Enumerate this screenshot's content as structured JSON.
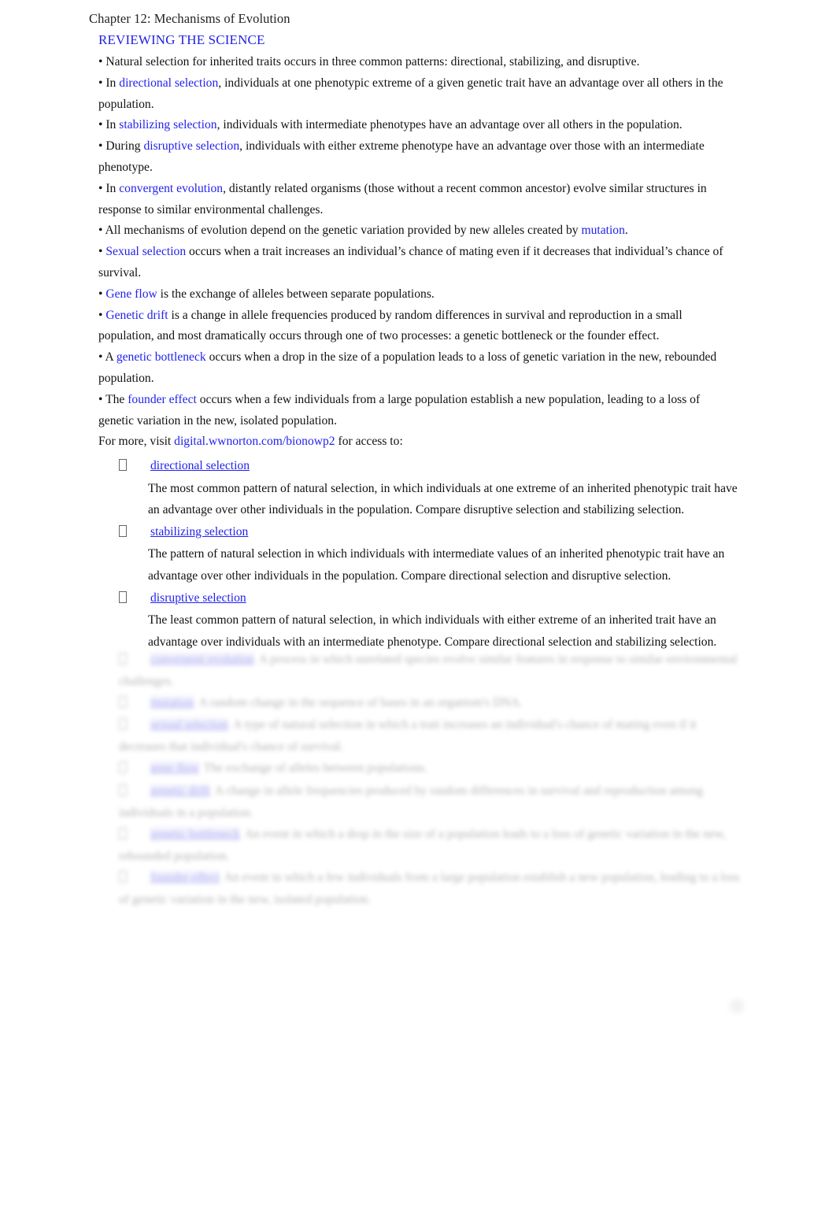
{
  "document": {
    "chapter_header": "Chapter 12: Mechanisms of Evolution",
    "section_title": "REVIEWING THE SCIENCE"
  },
  "bullets": [
    {
      "id": "patterns",
      "marker": "•",
      "segments": [
        {
          "type": "text",
          "value": " Natural selection for inherited traits occurs in three common patterns: directional, stabilizing, and disruptive."
        }
      ]
    },
    {
      "id": "directional",
      "marker": "•",
      "segments": [
        {
          "type": "text",
          "value": " In  "
        },
        {
          "type": "term",
          "value": "directional selection"
        },
        {
          "type": "text",
          "value": ", individuals at one phenotypic extreme of a given genetic trait have an advantage over all others in the population."
        }
      ]
    },
    {
      "id": "stabilizing",
      "marker": "•",
      "segments": [
        {
          "type": "text",
          "value": " In  "
        },
        {
          "type": "term",
          "value": "stabilizing selection"
        },
        {
          "type": "text",
          "value": ", individuals with intermediate phenotypes have an advantage over all others in the population."
        }
      ]
    },
    {
      "id": "disruptive",
      "marker": "•",
      "segments": [
        {
          "type": "text",
          "value": " During  "
        },
        {
          "type": "term",
          "value": "disruptive selection"
        },
        {
          "type": "text",
          "value": ", individuals with either extreme phenotype have an advantage over those with an intermediate phenotype."
        }
      ]
    },
    {
      "id": "convergent",
      "marker": "•",
      "segments": [
        {
          "type": "text",
          "value": " In  "
        },
        {
          "type": "term",
          "value": "convergent evolution"
        },
        {
          "type": "text",
          "value": ", distantly related organisms (those without a recent common ancestor) evolve similar structures in response to similar environmental challenges."
        }
      ]
    },
    {
      "id": "mutation",
      "marker": "•",
      "segments": [
        {
          "type": "text",
          "value": " All mechanisms of evolution depend on the genetic variation provided by new alleles created by  "
        },
        {
          "type": "term",
          "value": "mutation"
        },
        {
          "type": "text",
          "value": "."
        }
      ]
    },
    {
      "id": "sexual-selection",
      "marker": "•",
      "segments": [
        {
          "type": "text",
          "value": "  "
        },
        {
          "type": "term",
          "value": "Sexual selection"
        },
        {
          "type": "text",
          "value": " occurs when a trait increases an individual’s chance of mating even if it decreases  that individual’s chance of survival."
        }
      ]
    },
    {
      "id": "gene-flow",
      "marker": "•",
      "segments": [
        {
          "type": "text",
          "value": "  "
        },
        {
          "type": "term",
          "value": "Gene flow"
        },
        {
          "type": "text",
          "value": " is the exchange of alleles between separate populations."
        }
      ]
    },
    {
      "id": "genetic-drift",
      "marker": "•",
      "segments": [
        {
          "type": "text",
          "value": "  "
        },
        {
          "type": "term",
          "value": "Genetic drift"
        },
        {
          "type": "text",
          "value": " is a change in allele frequencies produced by random differences in survival and reproduction in a small population, and most dramatically occurs through one of two processes: a genetic bottleneck or the founder effect."
        }
      ]
    },
    {
      "id": "genetic-bottleneck",
      "marker": "•",
      "segments": [
        {
          "type": "text",
          "value": " A  "
        },
        {
          "type": "term",
          "value": "genetic bottleneck"
        },
        {
          "type": "text",
          "value": " occurs when a drop in the size of a population leads to a loss of genetic variation in the new, rebounded population."
        }
      ]
    },
    {
      "id": "founder-effect",
      "marker": "•",
      "segments": [
        {
          "type": "text",
          "value": " The  "
        },
        {
          "type": "term",
          "value": "founder effect"
        },
        {
          "type": "text",
          "value": " occurs when a few individuals from a large population establish a new population, leading to a loss of genetic variation in the new, isolated population."
        }
      ]
    }
  ],
  "for_more": {
    "prefix": "For more, visit ",
    "url_text": "digital.wwnorton.com/bionowp2",
    "suffix": " for access to:"
  },
  "glossary": {
    "marker_glyph": "\u0000",
    "items": [
      {
        "term": "directional selection",
        "definition": "The most common pattern of natural selection, in which individuals at one extreme of an inherited phenotypic trait have an advantage over other individuals in the population. Compare disruptive selection and stabilizing selection."
      },
      {
        "term": "stabilizing selection",
        "definition": "The pattern of natural selection in which individuals with intermediate values of an inherited phenotypic trait have an advantage over other individuals in the population. Compare directional selection  and disruptive selection."
      },
      {
        "term": "disruptive selection",
        "definition": "The least common pattern of natural selection, in which individuals with either extreme of an inherited trait have an advantage over individuals with an intermediate phenotype. Compare directional selection and stabilizing selection."
      }
    ],
    "faded_items": [
      {
        "term": "convergent evolution",
        "definition": "A process in which unrelated species evolve similar features in response to similar environmental challenges."
      },
      {
        "term": "mutation",
        "definition": "A random change in the sequence of bases in an organism's DNA."
      },
      {
        "term": "sexual selection",
        "definition": "A type of natural selection in which a trait increases an individual's chance of mating even if it decreases that individual's chance of survival."
      },
      {
        "term": "gene flow",
        "definition": "The exchange of alleles between populations."
      },
      {
        "term": "genetic drift",
        "definition": "A change in allele frequencies produced by random differences in survival and reproduction among individuals in a population."
      },
      {
        "term": "genetic bottleneck",
        "definition": "An event in which a drop in the size of a population leads to a loss of genetic variation in the new, rebounded population."
      },
      {
        "term": "founder effect",
        "definition": "An event in which a few individuals from a large population establish a new population, leading to a loss of genetic variation in the new, isolated population."
      }
    ]
  },
  "colors": {
    "link_blue": "#2222ee",
    "heading_blue": "#2323e0",
    "body_text": "#111111",
    "page_background": "#ffffff"
  }
}
